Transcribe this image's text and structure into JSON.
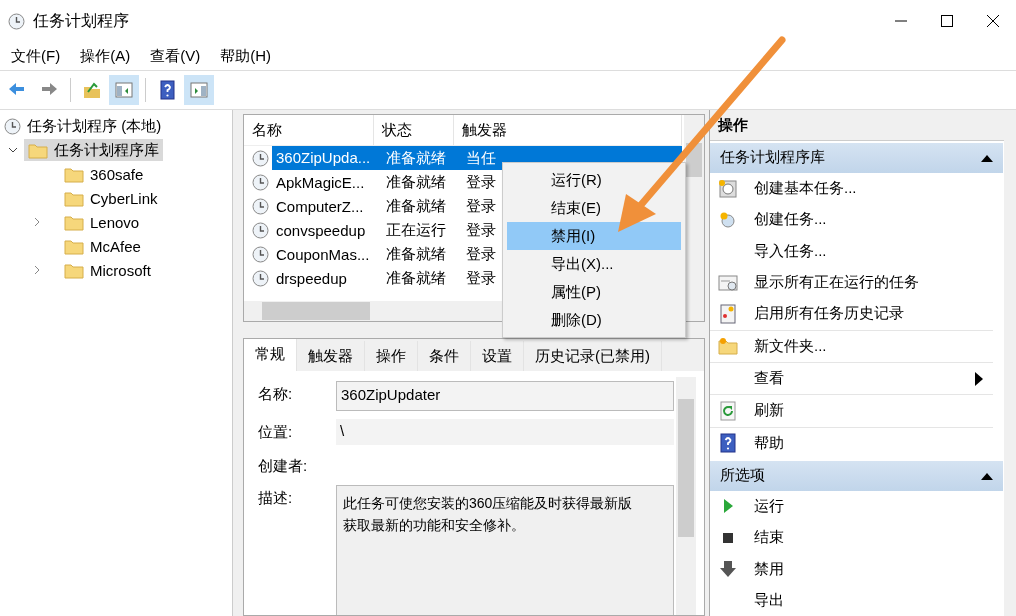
{
  "window": {
    "title": "任务计划程序"
  },
  "menu": [
    "文件(F)",
    "操作(A)",
    "查看(V)",
    "帮助(H)"
  ],
  "toolbar": [
    {
      "kind": "back",
      "selected": false
    },
    {
      "kind": "forward",
      "selected": false
    },
    {
      "kind": "up",
      "selected": false
    },
    {
      "kind": "left-pane",
      "selected": true
    },
    {
      "kind": "help",
      "selected": false
    },
    {
      "kind": "right-pane",
      "selected": true
    }
  ],
  "tree": {
    "label": "任务计划程序 (本地)",
    "children": [
      {
        "label": "任务计划程序库",
        "selected": true,
        "expanded": true,
        "children": [
          {
            "label": "360safe",
            "expandable": false
          },
          {
            "label": "CyberLink",
            "expandable": false
          },
          {
            "label": "Lenovo",
            "expandable": true
          },
          {
            "label": "McAfee",
            "expandable": false
          },
          {
            "label": "Microsoft",
            "expandable": true
          }
        ]
      }
    ]
  },
  "tasks": {
    "columns": [
      "名称",
      "状态",
      "触发器"
    ],
    "rows": [
      {
        "name": "360ZipUpda...",
        "status": "准备就绪",
        "trigger": "当任",
        "selected": true
      },
      {
        "name": "ApkMagicE...",
        "status": "准备就绪",
        "trigger": "登录",
        "selected": false
      },
      {
        "name": "ComputerZ...",
        "status": "准备就绪",
        "trigger": "登录",
        "selected": false
      },
      {
        "name": "convspeedup",
        "status": "正在运行",
        "trigger": "登录",
        "selected": false
      },
      {
        "name": "CouponMas...",
        "status": "准备就绪",
        "trigger": "登录",
        "selected": false
      },
      {
        "name": "drspeedup",
        "status": "准备就绪",
        "trigger": "登录",
        "selected": false
      }
    ]
  },
  "context_menu": [
    {
      "label": "运行(R)",
      "selected": false
    },
    {
      "label": "结束(E)",
      "selected": false
    },
    {
      "label": "禁用(I)",
      "selected": true
    },
    {
      "label": "导出(X)...",
      "selected": false
    },
    {
      "label": "属性(P)",
      "selected": false
    },
    {
      "label": "删除(D)",
      "selected": false
    }
  ],
  "details": {
    "tabs": [
      {
        "label": "常规",
        "selected": true
      },
      {
        "label": "触发器",
        "selected": false
      },
      {
        "label": "操作",
        "selected": false
      },
      {
        "label": "条件",
        "selected": false
      },
      {
        "label": "设置",
        "selected": false
      },
      {
        "label": "历史记录(已禁用)",
        "selected": false
      }
    ],
    "fields": [
      {
        "kind": "input",
        "label": "名称:",
        "value": "360ZipUpdater"
      },
      {
        "kind": "readonly",
        "label": "位置:",
        "value": "\\"
      },
      {
        "kind": "plain",
        "label": "创建者:"
      },
      {
        "kind": "textarea",
        "label": "描述:",
        "lines": [
          "此任务可使您安装的360压缩能及时获得最新版",
          "获取最新的功能和安全修补。"
        ]
      }
    ]
  },
  "actions": {
    "title": "操作",
    "sections": [
      {
        "title": "任务计划程序库",
        "items": [
          {
            "label": "创建基本任务...",
            "kind": "basic-task"
          },
          {
            "label": "创建任务...",
            "kind": "create-task"
          },
          {
            "label": "导入任务...",
            "kind": "none"
          },
          {
            "label": "显示所有正在运行的任务",
            "kind": "running"
          },
          {
            "label": "启用所有任务历史记录",
            "kind": "history"
          },
          {
            "label": "新文件夹...",
            "kind": "folder"
          },
          {
            "label": "查看",
            "kind": "submenu"
          },
          {
            "label": "刷新",
            "kind": "refresh"
          },
          {
            "label": "帮助",
            "kind": "help"
          }
        ]
      },
      {
        "title": "所选项",
        "items": [
          {
            "label": "运行",
            "kind": "run"
          },
          {
            "label": "结束",
            "kind": "end"
          },
          {
            "label": "禁用",
            "kind": "disable"
          },
          {
            "label": "导出",
            "kind": "none"
          }
        ]
      }
    ]
  }
}
